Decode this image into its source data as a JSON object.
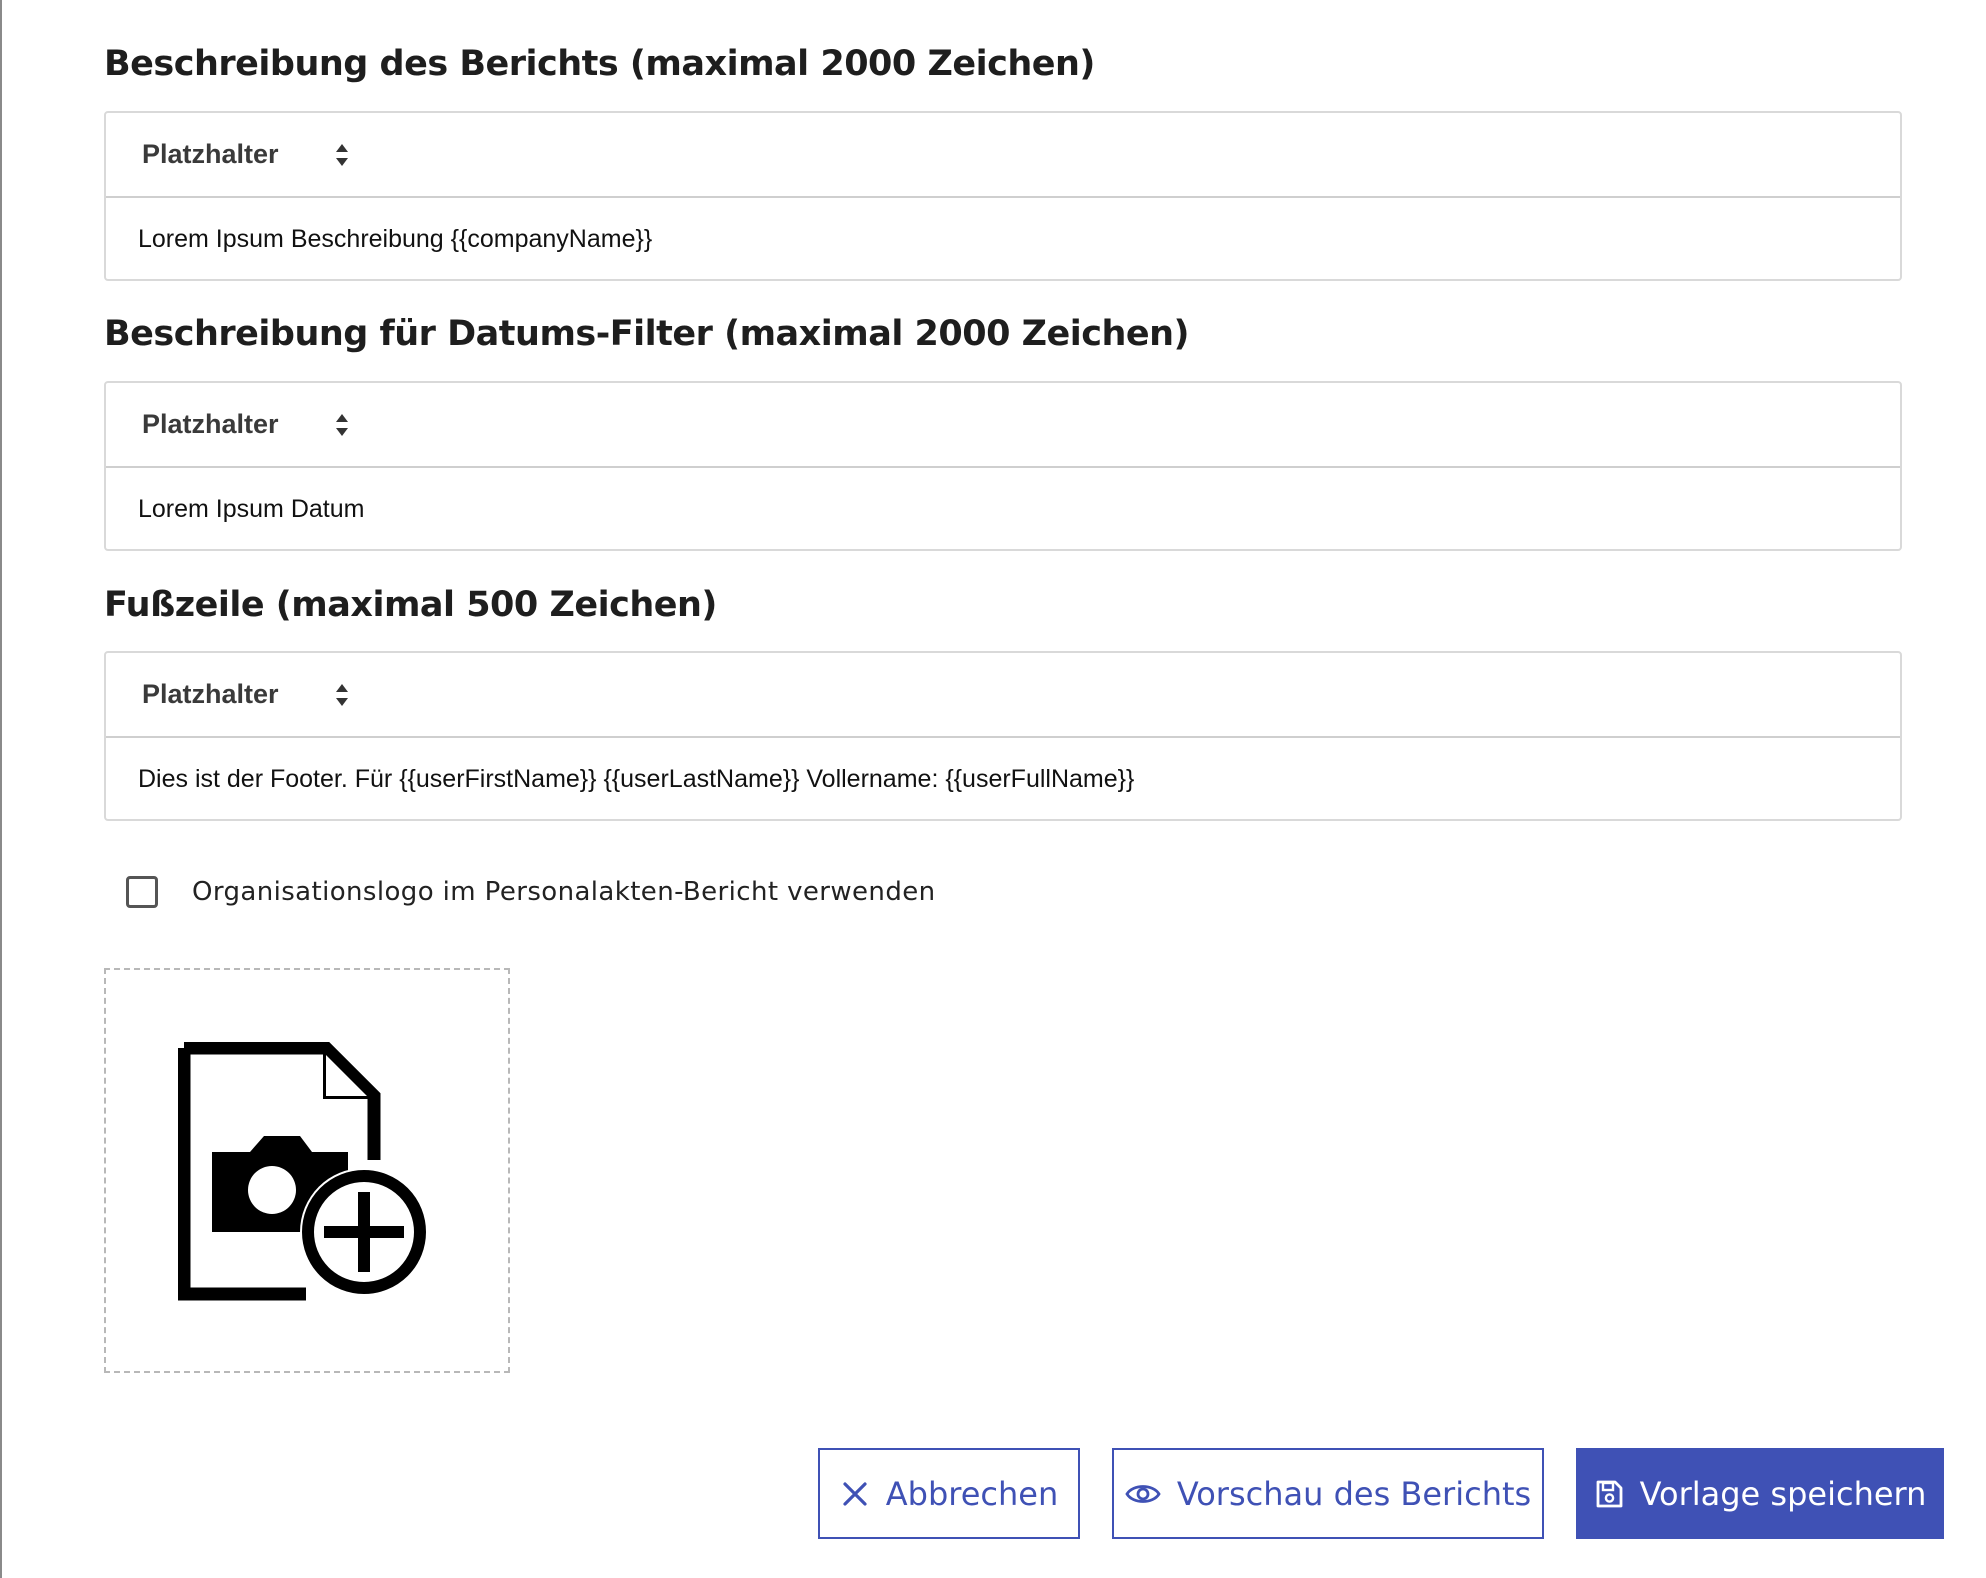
{
  "sections": [
    {
      "title": "Beschreibung des Berichts (maximal 2000 Zeichen)",
      "placeholder_label": "Platzhalter",
      "content": "Lorem Ipsum Beschreibung  {{companyName}}"
    },
    {
      "title": "Beschreibung für Datums-Filter (maximal 2000 Zeichen)",
      "placeholder_label": "Platzhalter",
      "content": "Lorem Ipsum Datum"
    },
    {
      "title": "Fußzeile (maximal 500 Zeichen)",
      "placeholder_label": "Platzhalter",
      "content": "Dies ist der Footer. Für {{userFirstName}} {{userLastName}} Vollername: {{userFullName}}"
    }
  ],
  "logo_option": {
    "label": "Organisationslogo im Personalakten-Bericht verwenden",
    "checked": false
  },
  "upload": {
    "icon": "add-photo-file-icon"
  },
  "actions": {
    "cancel_label": "Abbrechen",
    "preview_label": "Vorschau des Berichts",
    "save_label": "Vorlage speichern"
  },
  "colors": {
    "primary": "#3f51b5"
  }
}
